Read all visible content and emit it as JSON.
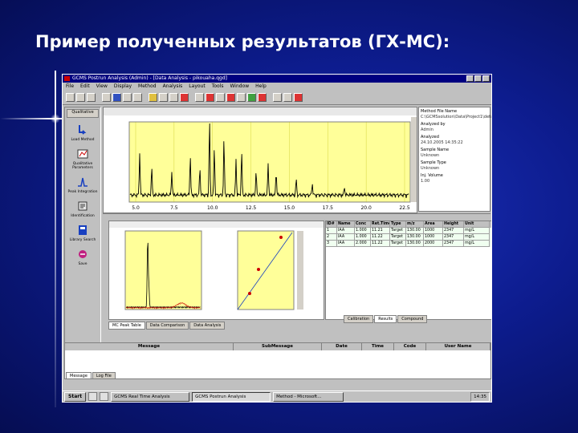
{
  "slide": {
    "title": "Пример полученных результатов (ГХ-МС):"
  },
  "window": {
    "title": "GCMS Postrun Analysis (Admin) - [Data Analysis - pikouaha.qgd]",
    "menu": [
      "File",
      "Edit",
      "View",
      "Display",
      "Method",
      "Analysis",
      "Layout",
      "Tools",
      "Window",
      "Help"
    ]
  },
  "left_panel": {
    "tab": "Qualitative",
    "items": [
      {
        "label": "Load Method",
        "icon": "load-method-icon"
      },
      {
        "label": "Qualitative Parameters",
        "icon": "qualitative-parameters-icon"
      },
      {
        "label": "Peak Integration",
        "icon": "peak-integration-icon"
      },
      {
        "label": "Identification",
        "icon": "identification-icon"
      },
      {
        "label": "Library Search",
        "icon": "library-search-icon"
      },
      {
        "label": "Save",
        "icon": "save-icon"
      }
    ]
  },
  "chromatogram": {
    "x_ticks": [
      "5.0",
      "7.5",
      "10.0",
      "12.5",
      "15.0",
      "17.5",
      "20.0",
      "22.5"
    ]
  },
  "info_panel": {
    "rows": [
      {
        "k": "Method File Name",
        "v": "C:\\GCMSsolution\\Data\\Project1\\default.qgm"
      },
      {
        "k": "Analyzed by",
        "v": "Admin"
      },
      {
        "k": "Analyzed",
        "v": "24.10.2005 14:35:22"
      },
      {
        "k": "Sample Name",
        "v": "Unknown"
      },
      {
        "k": "Sample Type",
        "v": "Unknown"
      },
      {
        "k": "Inj. Volume",
        "v": "1.00"
      }
    ]
  },
  "spectrum": {
    "tabs": [
      "MC Peak Table",
      "Data Comparison",
      "Data Analysis"
    ]
  },
  "results_table": {
    "headers": [
      "ID#",
      "Name",
      "Conc",
      "Ret.Time",
      "Type",
      "m/z",
      "Area",
      "Height",
      "Unit"
    ],
    "rows": [
      [
        "1",
        "IAA",
        "1.000",
        "11.21",
        "Target",
        "130.00",
        "1000",
        "2347",
        "mg/L"
      ],
      [
        "2",
        "IAA",
        "1.000",
        "11.22",
        "Target",
        "130.00",
        "1000",
        "2347",
        "mg/L"
      ],
      [
        "3",
        "IAA",
        "2.000",
        "11.22",
        "Target",
        "130.00",
        "2000",
        "2347",
        "mg/L"
      ]
    ],
    "tabs": [
      "Calibration",
      "Results",
      "Compound"
    ]
  },
  "messages": {
    "headers": [
      "Message",
      "SubMessage",
      "Date",
      "Time",
      "Code",
      "User Name"
    ],
    "tabs": [
      "Message",
      "Log File"
    ]
  },
  "taskbar": {
    "start": "Start",
    "tasks": [
      "GCMS Real Time Analysis",
      "GCMS Postrun Analysis",
      "Method - Microsoft..."
    ],
    "clock": "14:35"
  },
  "colors": {
    "slide_bg": "#0d1c8e",
    "plot_bg": "#ffff99",
    "trace": "#000000",
    "title_bar": "#000080",
    "grid": "#b8b800"
  }
}
